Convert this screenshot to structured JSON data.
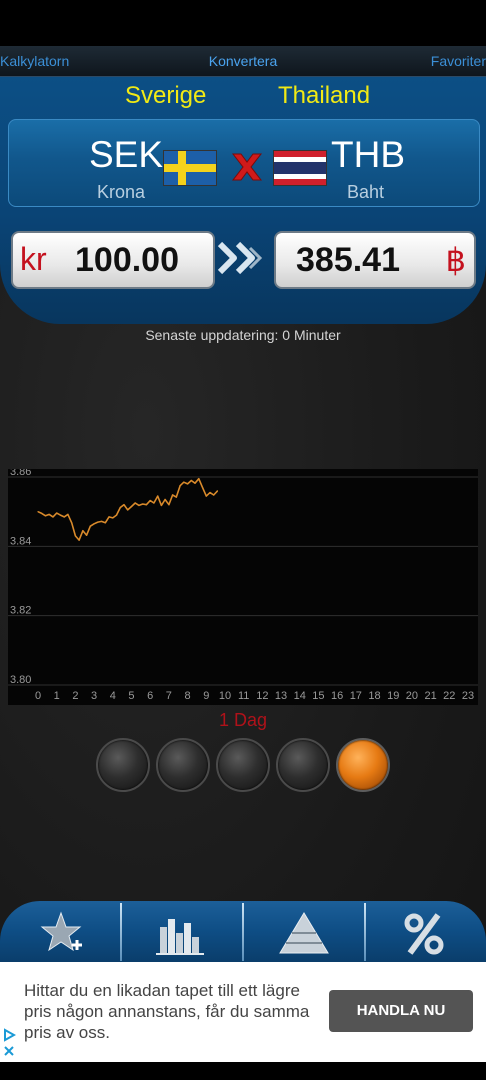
{
  "tabs": {
    "left": "Kalkylatorn",
    "center": "Konvertera",
    "right": "Favoriter"
  },
  "from": {
    "country": "Sverige",
    "code": "SEK",
    "name": "Krona",
    "symbol": "kr",
    "amount": "100.00"
  },
  "to": {
    "country": "Thailand",
    "code": "THB",
    "name": "Baht",
    "symbol": "฿",
    "amount": "385.41"
  },
  "updated": "Senaste uppdatering: 0 Minuter",
  "period_label": "1 Dag",
  "period_buttons": [
    "button-1",
    "button-2",
    "button-3",
    "button-4",
    "button-5-active"
  ],
  "colors": {
    "accent": "#f2ea14",
    "line": "#d98a2b",
    "symbol": "#c4111e"
  },
  "bottom_nav_icons": [
    "star-add-icon",
    "bar-chart-icon",
    "pyramid-icon",
    "percent-icon"
  ],
  "ad": {
    "text": "Hittar du en likadan tapet till ett lägre pris någon annanstans, får du samma pris av oss.",
    "button": "HANDLA NU"
  },
  "chart_data": {
    "type": "line",
    "xlabel": "",
    "ylabel": "",
    "x_ticks": [
      "0",
      "1",
      "2",
      "3",
      "4",
      "5",
      "6",
      "7",
      "8",
      "9",
      "10",
      "11",
      "12",
      "13",
      "14",
      "15",
      "16",
      "17",
      "18",
      "19",
      "20",
      "21",
      "22",
      "23"
    ],
    "y_ticks": [
      "3.80",
      "3.82",
      "3.84",
      "3.86"
    ],
    "ylim": [
      3.8,
      3.86
    ],
    "xlim": [
      0,
      23
    ],
    "series": [
      {
        "values": [
          [
            0.0,
            3.85
          ],
          [
            0.2,
            3.8495
          ],
          [
            0.4,
            3.8488
          ],
          [
            0.6,
            3.8492
          ],
          [
            0.8,
            3.8485
          ],
          [
            1.0,
            3.8496
          ],
          [
            1.2,
            3.849
          ],
          [
            1.4,
            3.8485
          ],
          [
            1.6,
            3.8492
          ],
          [
            1.8,
            3.8468
          ],
          [
            2.0,
            3.843
          ],
          [
            2.2,
            3.8418
          ],
          [
            2.4,
            3.8445
          ],
          [
            2.6,
            3.8432
          ],
          [
            2.8,
            3.8458
          ],
          [
            3.0,
            3.8465
          ],
          [
            3.2,
            3.847
          ],
          [
            3.4,
            3.8472
          ],
          [
            3.6,
            3.8468
          ],
          [
            3.8,
            3.8485
          ],
          [
            4.0,
            3.8482
          ],
          [
            4.2,
            3.849
          ],
          [
            4.4,
            3.8512
          ],
          [
            4.6,
            3.852
          ],
          [
            4.8,
            3.8505
          ],
          [
            5.0,
            3.8515
          ],
          [
            5.2,
            3.8525
          ],
          [
            5.4,
            3.8518
          ],
          [
            5.6,
            3.8522
          ],
          [
            5.8,
            3.852
          ],
          [
            6.0,
            3.8532
          ],
          [
            6.2,
            3.8525
          ],
          [
            6.4,
            3.8545
          ],
          [
            6.6,
            3.8518
          ],
          [
            6.8,
            3.8535
          ],
          [
            7.0,
            3.852
          ],
          [
            7.2,
            3.8548
          ],
          [
            7.4,
            3.8542
          ],
          [
            7.6,
            3.8575
          ],
          [
            7.8,
            3.8585
          ],
          [
            8.0,
            3.858
          ],
          [
            8.2,
            3.859
          ],
          [
            8.4,
            3.8582
          ],
          [
            8.6,
            3.8595
          ],
          [
            8.8,
            3.857
          ],
          [
            9.0,
            3.8545
          ],
          [
            9.2,
            3.8555
          ],
          [
            9.4,
            3.8548
          ],
          [
            9.6,
            3.856
          ]
        ]
      }
    ],
    "grid": true
  }
}
